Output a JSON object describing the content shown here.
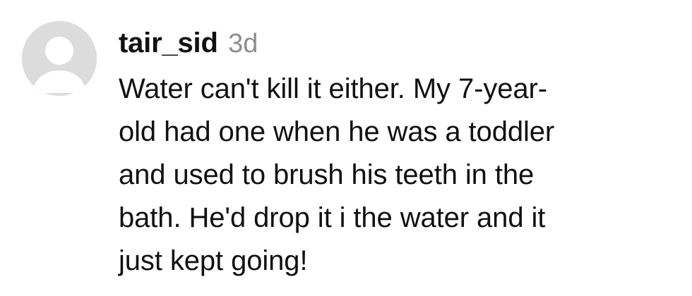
{
  "comment": {
    "username": "tair_sid",
    "timestamp": "3d",
    "lines": [
      "Water can't kill it either. My 7-year-",
      "old had one when he was a toddler",
      "and used to brush his teeth in the",
      "bath. He'd drop it i the water and it",
      "just kept going!"
    ]
  },
  "avatar": {
    "icon": "default-avatar-icon",
    "background_color": "#dcdcdc",
    "silhouette_color": "#ffffff"
  },
  "colors": {
    "text": "#111111",
    "muted": "#8e8e8e",
    "background": "#ffffff"
  }
}
